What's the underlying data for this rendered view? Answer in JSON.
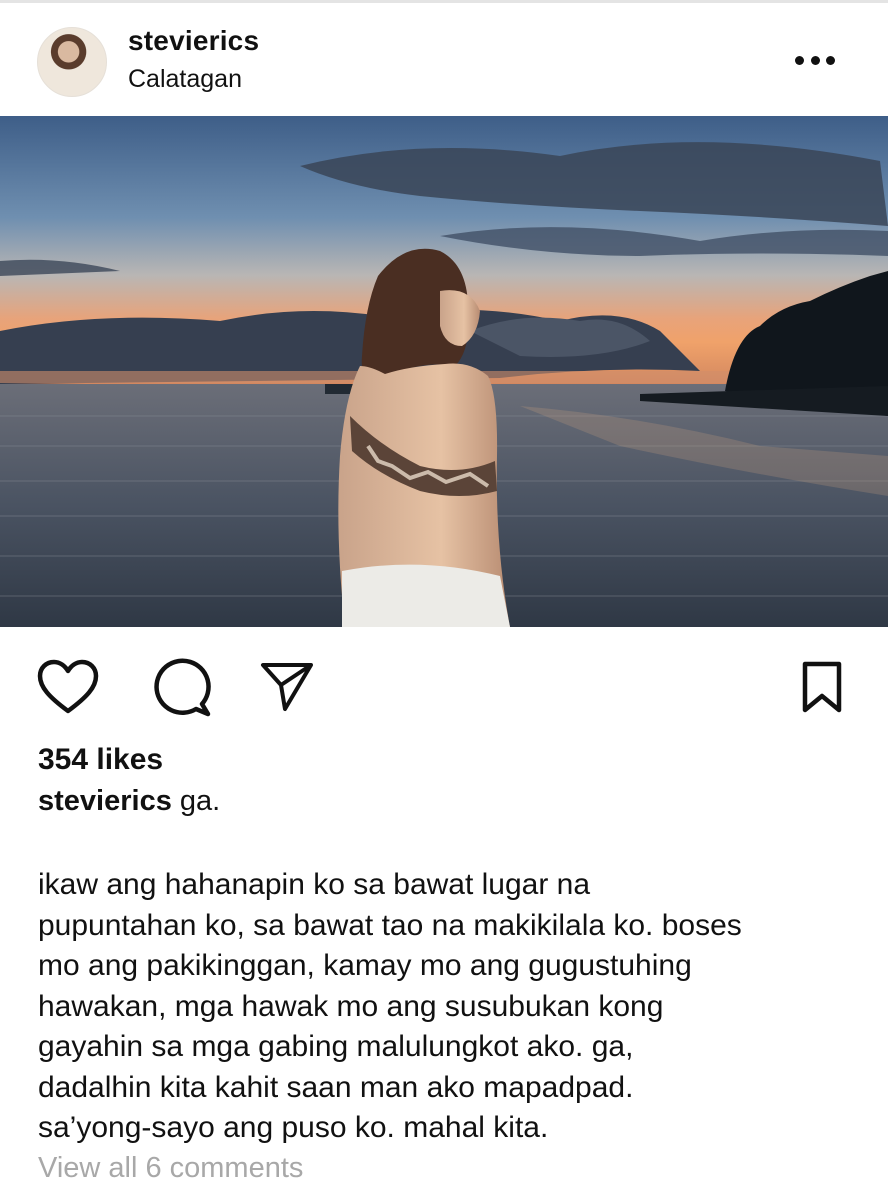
{
  "post": {
    "username": "stevierics",
    "location": "Calatagan",
    "likes": "354 likes",
    "caption": {
      "username": "stevierics",
      "text": "ga."
    },
    "body_lines": [
      "ikaw ang hahanapin ko sa bawat lugar na",
      "pupuntahan ko, sa bawat tao na makikilala ko. boses",
      "mo ang pakikinggan, kamay mo ang gugustuhing",
      "hawakan, mga hawak mo ang susubukan kong",
      "gayahin sa mga gabing malulungkot ako. ga,",
      "dadalhin kita kahit saan man ako mapadpad.",
      "sa’yong-sayo ang puso ko. mahal kita."
    ],
    "view_comments": "View all 6 comments"
  },
  "icons": {
    "more": "more-options-icon",
    "like": "heart-icon",
    "comment": "comment-bubble-icon",
    "share": "paper-plane-icon",
    "save": "bookmark-icon"
  },
  "colors": {
    "text": "#111111",
    "muted": "#a8a8a8",
    "background": "#ffffff"
  }
}
